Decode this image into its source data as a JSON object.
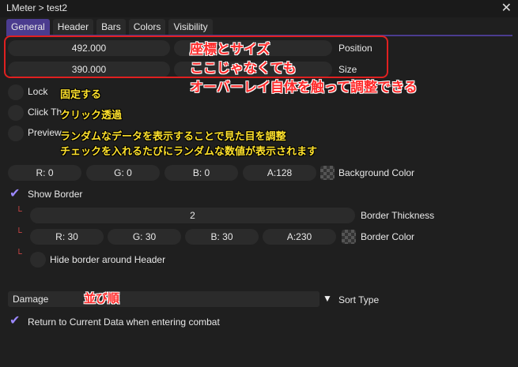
{
  "window": {
    "title": "LMeter > test2",
    "close_label": "✕"
  },
  "tabs": [
    "General",
    "Header",
    "Bars",
    "Colors",
    "Visibility"
  ],
  "position": {
    "x": "492.000",
    "label": "Position"
  },
  "size": {
    "x": "390.000",
    "label": "Size"
  },
  "checkboxes": {
    "lock": "Lock",
    "click_through": "Click Th",
    "preview": "Preview"
  },
  "background": {
    "r": "R: 0",
    "g": "G: 0",
    "b": "B: 0",
    "a": "A:128",
    "label": "Background Color"
  },
  "show_border": {
    "label": "Show Border"
  },
  "border_thickness": {
    "value": "2",
    "label": "Border Thickness"
  },
  "border_color": {
    "r": "R: 30",
    "g": "G: 30",
    "b": "B: 30",
    "a": "A:230",
    "label": "Border Color"
  },
  "hide_border": {
    "label": "Hide border around Header"
  },
  "sort": {
    "value": "Damage",
    "label": "Sort Type"
  },
  "return_data": {
    "label": "Return to Current Data when entering combat"
  },
  "annotations": {
    "red1": "座標とサイズ",
    "red2": "ここじゃなくても",
    "red3": "オーバーレイ自体を触って調整できる",
    "lock_note": "固定する",
    "click_note": "クリック透過",
    "preview1": "ランダムなデータを表示することで見た目を調整",
    "preview2": "チェックを入れるたびにランダムな数値が表示されます",
    "sort_note": "並び順"
  },
  "colors": {
    "accent": "#4b3c8f",
    "check": "#9c88ff"
  }
}
